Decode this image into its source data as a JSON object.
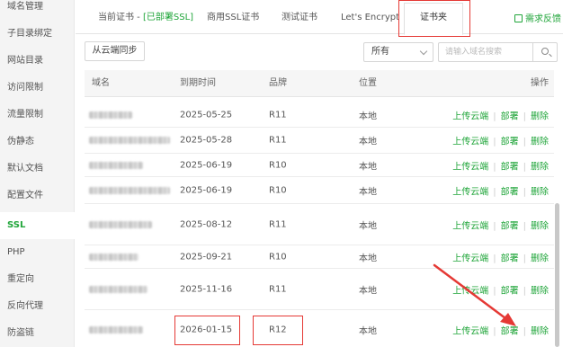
{
  "sidebar": {
    "items": [
      {
        "label": "域名管理"
      },
      {
        "label": "子目录绑定"
      },
      {
        "label": "网站目录"
      },
      {
        "label": "访问限制"
      },
      {
        "label": "流量限制"
      },
      {
        "label": "伪静态"
      },
      {
        "label": "默认文档"
      },
      {
        "label": "配置文件"
      },
      {
        "label": "SSL"
      },
      {
        "label": "PHP"
      },
      {
        "label": "重定向"
      },
      {
        "label": "反向代理"
      },
      {
        "label": "防盗链"
      }
    ],
    "active_index": 8
  },
  "tabs": {
    "current": {
      "label": "当前证书 - ",
      "highlight": "[已部署SSL]"
    },
    "commercial": "商用SSL证书",
    "test": "测试证书",
    "letsencrypt": "Let's Encrypt",
    "folder": "证书夹",
    "feedback": "需求反馈"
  },
  "toolbar": {
    "sync_label": "从云端同步",
    "filter_value": "所有",
    "search_placeholder": "请输入域名搜索"
  },
  "table": {
    "headers": {
      "domain": "域名",
      "expiry": "到期时间",
      "brand": "品牌",
      "location": "位置",
      "action": "操作"
    },
    "rows": [
      {
        "expiry": "2025-05-25",
        "brand": "R11",
        "location": "本地"
      },
      {
        "expiry": "2025-05-28",
        "brand": "R11",
        "location": "本地"
      },
      {
        "expiry": "2025-06-19",
        "brand": "R10",
        "location": "本地"
      },
      {
        "expiry": "2025-06-19",
        "brand": "R10",
        "location": "本地"
      },
      {
        "expiry": "2025-08-12",
        "brand": "R11",
        "location": "本地"
      },
      {
        "expiry": "2025-09-21",
        "brand": "R10",
        "location": "本地"
      },
      {
        "expiry": "2025-11-16",
        "brand": "R11",
        "location": "本地"
      },
      {
        "expiry": "2026-01-15",
        "brand": "R12",
        "location": "本地"
      }
    ],
    "actions": {
      "upload": "上传云端",
      "deploy": "部署",
      "delete": "删除"
    }
  },
  "colors": {
    "accent": "#20a53a",
    "highlight_box": "#e53935"
  }
}
